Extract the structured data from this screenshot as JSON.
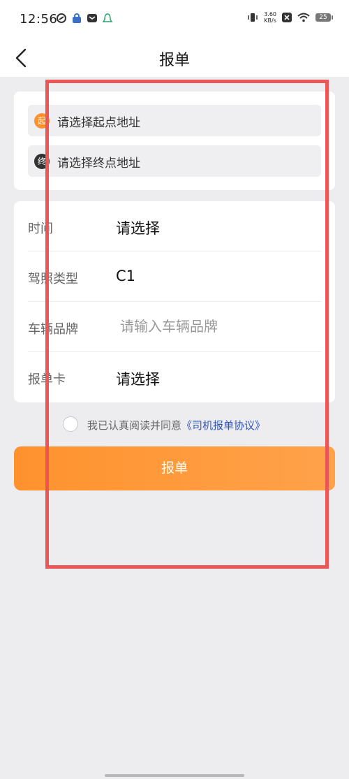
{
  "status_bar": {
    "time": "12:56",
    "net_speed_value": "3.60",
    "net_speed_unit": "KB/s",
    "battery": "25"
  },
  "header": {
    "title": "报单"
  },
  "address": {
    "start_badge": "起",
    "start_placeholder": "请选择起点地址",
    "end_badge": "终",
    "end_placeholder": "请选择终点地址"
  },
  "form": {
    "time_label": "时间",
    "time_value": "请选择",
    "license_label": "驾照类型",
    "license_value": "C1",
    "brand_label": "车辆品牌",
    "brand_placeholder": "请输入车辆品牌",
    "card_label": "报单卡",
    "card_value": "请选择"
  },
  "agreement": {
    "text": "我已认真阅读并同意",
    "link": "《司机报单协议》"
  },
  "submit_label": "报单",
  "colors": {
    "accent_orange": "#ff922e",
    "link_blue": "#2f57c0",
    "annotation_red": "#ec5656",
    "end_badge": "#333333"
  },
  "icons": [
    "back-arrow",
    "vibrate",
    "close-box",
    "wifi",
    "battery",
    "app-notification"
  ]
}
